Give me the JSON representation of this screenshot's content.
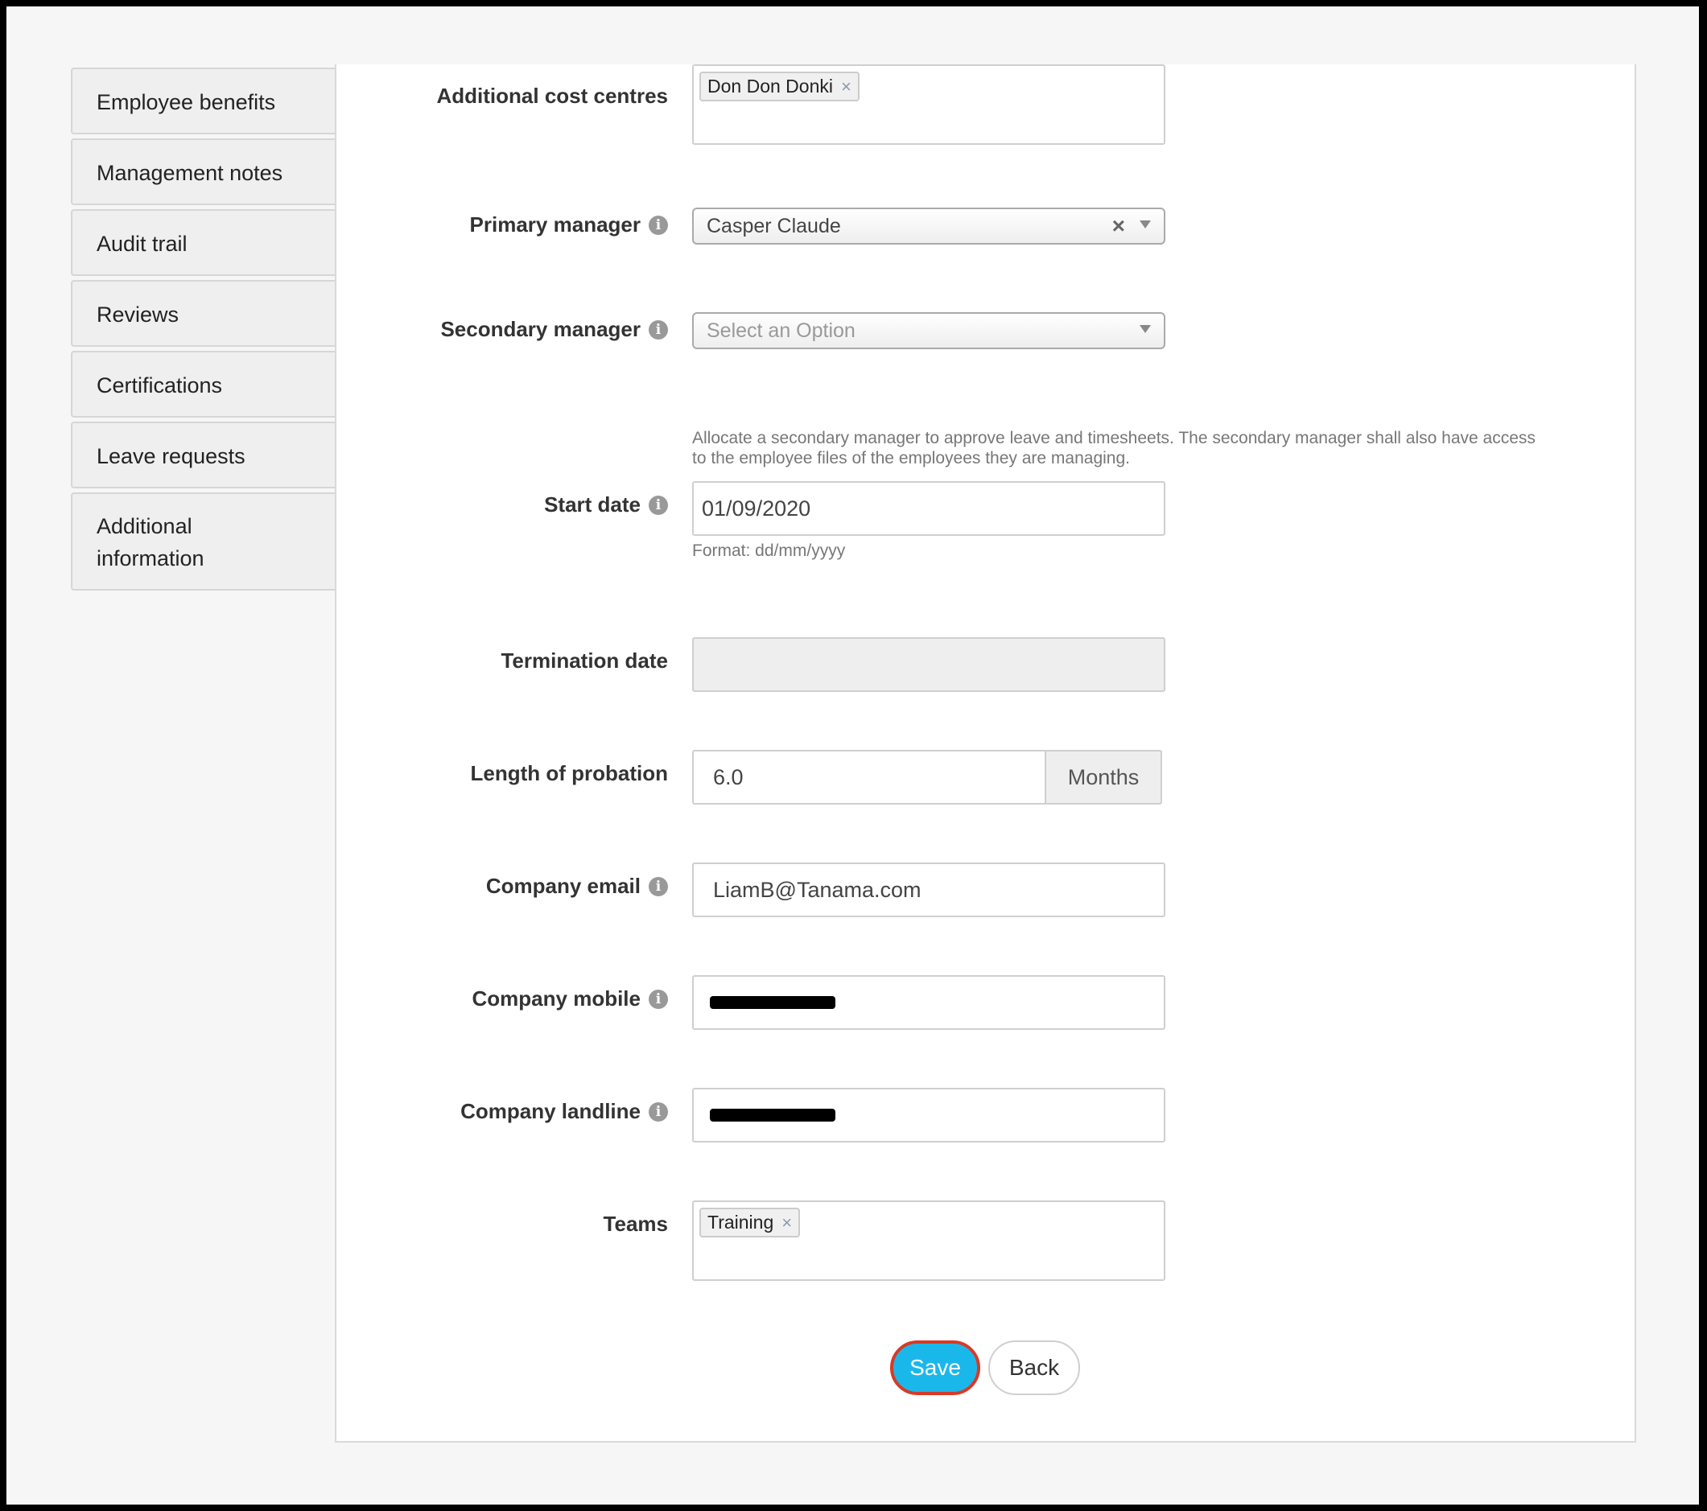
{
  "sidebar": {
    "items": [
      {
        "label": "Employee benefits"
      },
      {
        "label": "Management notes"
      },
      {
        "label": "Audit trail"
      },
      {
        "label": "Reviews"
      },
      {
        "label": "Certifications"
      },
      {
        "label": "Leave requests"
      },
      {
        "label": "Additional information"
      }
    ]
  },
  "form": {
    "cost_centres": {
      "label": "Additional cost centres",
      "tags": [
        "Don Don Donki"
      ]
    },
    "primary_manager": {
      "label": "Primary manager",
      "value": "Casper Claude"
    },
    "secondary_manager": {
      "label": "Secondary manager",
      "placeholder": "Select an Option",
      "help": "Allocate a secondary manager to approve leave and timesheets. The secondary manager shall also have access to the employee files of the employees they are managing."
    },
    "start_date": {
      "label": "Start date",
      "value": "01/09/2020",
      "help": "Format: dd/mm/yyyy"
    },
    "termination_date": {
      "label": "Termination date",
      "value": ""
    },
    "probation": {
      "label": "Length of probation",
      "value": "6.0",
      "unit": "Months"
    },
    "company_email": {
      "label": "Company email",
      "value": "LiamB@Tanama.com"
    },
    "company_mobile": {
      "label": "Company mobile"
    },
    "company_landline": {
      "label": "Company landline"
    },
    "teams": {
      "label": "Teams",
      "tags": [
        "Training"
      ]
    }
  },
  "icons": {
    "info": "info-icon",
    "remove": "×"
  },
  "actions": {
    "save": "Save",
    "back": "Back"
  },
  "colors": {
    "save_button": "#1ab8ea",
    "highlight_ring": "#d83a27"
  }
}
